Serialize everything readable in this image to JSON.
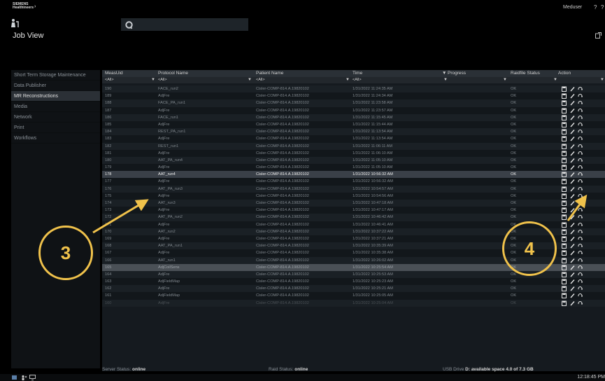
{
  "topbar": {
    "logo_line1": "SIEMENS",
    "logo_line2": "Healthineers",
    "user": "Meduser",
    "help": "?",
    "help2": "?"
  },
  "page_title": "Job View",
  "sidebar": {
    "items": [
      {
        "label": "Short Term Storage Maintenance",
        "active": false
      },
      {
        "label": "Data Publisher",
        "active": false
      },
      {
        "label": "MR Reconstructions",
        "active": true
      },
      {
        "label": "Media",
        "active": false
      },
      {
        "label": "Network",
        "active": false
      },
      {
        "label": "Print",
        "active": false
      },
      {
        "label": "Workflows",
        "active": false
      }
    ]
  },
  "table": {
    "headers": {
      "meas_uid": "MeasUid",
      "protocol": "Protocol Name",
      "patient": "Patient Name",
      "time": "Time",
      "progress": "Progress",
      "raid": "Raidfile Status",
      "action": "Action"
    },
    "progress_sort_indicator": "▼",
    "filters": {
      "meas_uid": "<All>",
      "protocol": "<All>",
      "patient": "<All>",
      "time": "<All>",
      "caret": "▼"
    },
    "rows": [
      {
        "meas": "190",
        "proto": "FACE_run2",
        "patient": "Cisler-COMP-814.A.19820102",
        "time": "1/31/2022 11:24:35 AM",
        "raid": "OK",
        "state": ""
      },
      {
        "meas": "189",
        "proto": "AdjFre",
        "patient": "Cisler-COMP-814.A.19820102",
        "time": "1/31/2022 11:24:34 AM",
        "raid": "OK",
        "state": ""
      },
      {
        "meas": "188",
        "proto": "FACE_PA_run1",
        "patient": "Cisler-COMP-814.A.19820102",
        "time": "1/31/2022 11:23:58 AM",
        "raid": "OK",
        "state": ""
      },
      {
        "meas": "187",
        "proto": "AdjFre",
        "patient": "Cisler-COMP-814.A.19820102",
        "time": "1/31/2022 11:23:57 AM",
        "raid": "OK",
        "state": ""
      },
      {
        "meas": "186",
        "proto": "FACE_run1",
        "patient": "Cisler-COMP-814.A.19820102",
        "time": "1/31/2022 11:15:45 AM",
        "raid": "OK",
        "state": ""
      },
      {
        "meas": "185",
        "proto": "AdjFre",
        "patient": "Cisler-COMP-814.A.19820102",
        "time": "1/31/2022 11:15:44 AM",
        "raid": "OK",
        "state": ""
      },
      {
        "meas": "184",
        "proto": "REST_PA_run1",
        "patient": "Cisler-COMP-814.A.19820102",
        "time": "1/31/2022 11:13:54 AM",
        "raid": "OK",
        "state": ""
      },
      {
        "meas": "183",
        "proto": "AdjFre",
        "patient": "Cisler-COMP-814.A.19820102",
        "time": "1/31/2022 11:13:54 AM",
        "raid": "OK",
        "state": ""
      },
      {
        "meas": "182",
        "proto": "REST_run1",
        "patient": "Cisler-COMP-814.A.19820102",
        "time": "1/31/2022 11:06:11 AM",
        "raid": "OK",
        "state": ""
      },
      {
        "meas": "181",
        "proto": "AdjFre",
        "patient": "Cisler-COMP-814.A.19820102",
        "time": "1/31/2022 11:06:10 AM",
        "raid": "OK",
        "state": ""
      },
      {
        "meas": "180",
        "proto": "AAT_PA_run4",
        "patient": "Cisler-COMP-814.A.19820102",
        "time": "1/31/2022 11:05:10 AM",
        "raid": "OK",
        "state": ""
      },
      {
        "meas": "179",
        "proto": "AdjFre",
        "patient": "Cisler-COMP-814.A.19820102",
        "time": "1/31/2022 11:05:10 AM",
        "raid": "OK",
        "state": ""
      },
      {
        "meas": "178",
        "proto": "AAT_run4",
        "patient": "Cisler-COMP-814.A.19820102",
        "time": "1/31/2022 10:56:32 AM",
        "raid": "OK",
        "state": "selected"
      },
      {
        "meas": "177",
        "proto": "AdjFre",
        "patient": "Cisler-COMP-814.A.19820102",
        "time": "1/31/2022 10:56:32 AM",
        "raid": "OK",
        "state": ""
      },
      {
        "meas": "176",
        "proto": "AAT_PA_run3",
        "patient": "Cisler-COMP-814.A.19820102",
        "time": "1/31/2022 10:54:57 AM",
        "raid": "OK",
        "state": ""
      },
      {
        "meas": "175",
        "proto": "AdjFre",
        "patient": "Cisler-COMP-814.A.19820102",
        "time": "1/31/2022 10:54:56 AM",
        "raid": "OK",
        "state": ""
      },
      {
        "meas": "174",
        "proto": "AAT_run3",
        "patient": "Cisler-COMP-814.A.19820102",
        "time": "1/31/2022 10:47:18 AM",
        "raid": "OK",
        "state": ""
      },
      {
        "meas": "173",
        "proto": "AdjFre",
        "patient": "Cisler-COMP-814.A.19820102",
        "time": "1/31/2022 10:47:17 AM",
        "raid": "OK",
        "state": ""
      },
      {
        "meas": "172",
        "proto": "AAT_PA_run2",
        "patient": "Cisler-COMP-814.A.19820102",
        "time": "1/31/2022 10:46:42 AM",
        "raid": "OK",
        "state": ""
      },
      {
        "meas": "171",
        "proto": "AdjFre",
        "patient": "Cisler-COMP-814.A.19820102",
        "time": "1/31/2022 10:46:41 AM",
        "raid": "OK",
        "state": ""
      },
      {
        "meas": "170",
        "proto": "AAT_run2",
        "patient": "Cisler-COMP-814.A.19820102",
        "time": "1/31/2022 10:37:22 AM",
        "raid": "OK",
        "state": ""
      },
      {
        "meas": "169",
        "proto": "AdjFre",
        "patient": "Cisler-COMP-814.A.19820102",
        "time": "1/31/2022 10:37:21 AM",
        "raid": "OK",
        "state": ""
      },
      {
        "meas": "168",
        "proto": "AAT_PA_run1",
        "patient": "Cisler-COMP-814.A.19820102",
        "time": "1/31/2022 10:35:39 AM",
        "raid": "OK",
        "state": ""
      },
      {
        "meas": "167",
        "proto": "AdjFre",
        "patient": "Cisler-COMP-814.A.19820102",
        "time": "1/31/2022 10:35:38 AM",
        "raid": "OK",
        "state": ""
      },
      {
        "meas": "166",
        "proto": "AAT_run1",
        "patient": "Cisler-COMP-814.A.19820102",
        "time": "1/31/2022 10:26:02 AM",
        "raid": "OK",
        "state": ""
      },
      {
        "meas": "165",
        "proto": "AdjCoilSens",
        "patient": "Cisler-COMP-814.A.19820102",
        "time": "1/31/2022 10:25:54 AM",
        "raid": "OK",
        "state": "highlight"
      },
      {
        "meas": "164",
        "proto": "AdjFre",
        "patient": "Cisler-COMP-814.A.19820102",
        "time": "1/31/2022 10:25:53 AM",
        "raid": "OK",
        "state": ""
      },
      {
        "meas": "163",
        "proto": "AdjFieldMap",
        "patient": "Cisler-COMP-814.A.19820102",
        "time": "1/31/2022 10:25:23 AM",
        "raid": "OK",
        "state": ""
      },
      {
        "meas": "162",
        "proto": "AdjFre",
        "patient": "Cisler-COMP-814.A.19820102",
        "time": "1/31/2022 10:25:21 AM",
        "raid": "OK",
        "state": ""
      },
      {
        "meas": "161",
        "proto": "AdjFieldMap",
        "patient": "Cisler-COMP-814.A.19820102",
        "time": "1/31/2022 10:25:05 AM",
        "raid": "OK",
        "state": ""
      },
      {
        "meas": "160",
        "proto": "AdjFre",
        "patient": "Cisler-COMP-814.A.19820102",
        "time": "1/31/2022 10:25:04 AM",
        "raid": "OK",
        "state": "partial"
      }
    ]
  },
  "statusbar": {
    "server_label": "Server Status:",
    "server_value": "online",
    "raid_label": "Raid Status:",
    "raid_value": "online",
    "usb_label": "USB Drive",
    "usb_value": "D: available space 4.0 of 7.3 GB"
  },
  "taskbar": {
    "clock": "12:18:45 PM"
  },
  "callouts": {
    "left": "3",
    "right": "4"
  },
  "colors": {
    "callout": "#f0c24b",
    "selected_row": "#3a4048",
    "highlight_row": "#4a5056"
  }
}
